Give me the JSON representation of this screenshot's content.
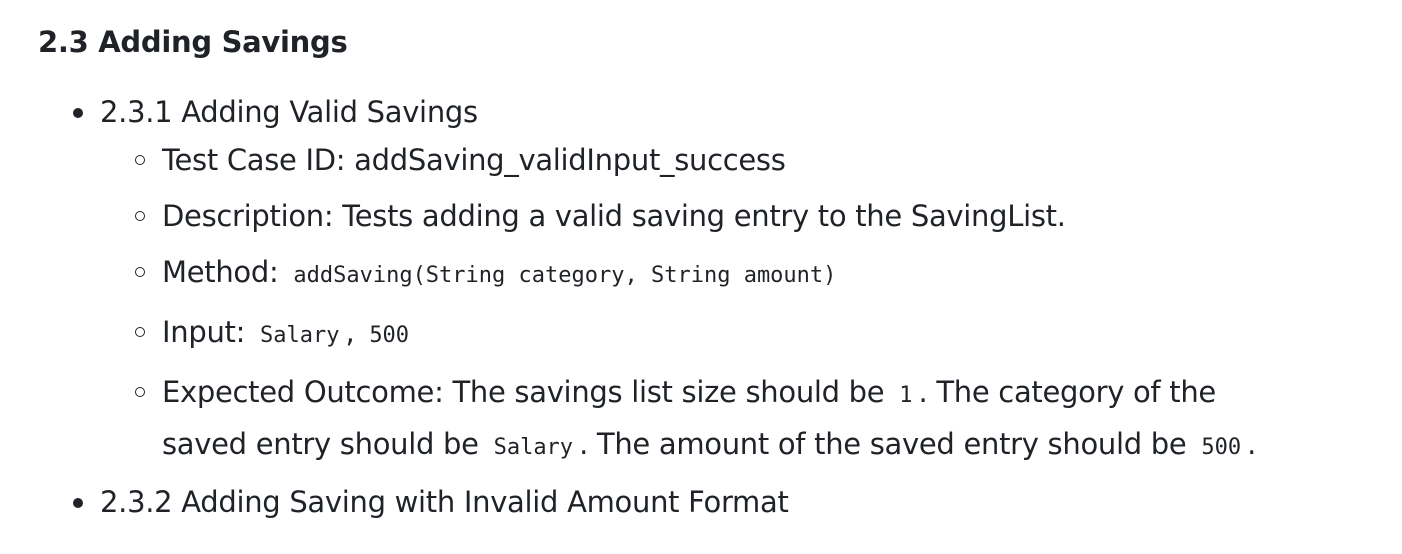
{
  "heading": "2.3 Adding Savings",
  "items": [
    {
      "title": "2.3.1 Adding Valid Savings",
      "test_case_id": "Test Case ID: addSaving_validInput_success",
      "description": "Description: Tests adding a valid saving entry to the SavingList.",
      "method_label": "Method:",
      "method_code": "addSaving(String category, String amount)",
      "input_label": "Input:",
      "input_code_1": "Salary",
      "input_separator": ",",
      "input_code_2": "500",
      "outcome_text_1": "Expected Outcome: The savings list size should be",
      "outcome_code_1": "1",
      "outcome_text_2": ". The category of the saved entry should be",
      "outcome_code_2": "Salary",
      "outcome_text_3": ". The amount of the saved entry should be",
      "outcome_code_3": "500",
      "outcome_text_4": "."
    },
    {
      "title": "2.3.2 Adding Saving with Invalid Amount Format"
    }
  ]
}
